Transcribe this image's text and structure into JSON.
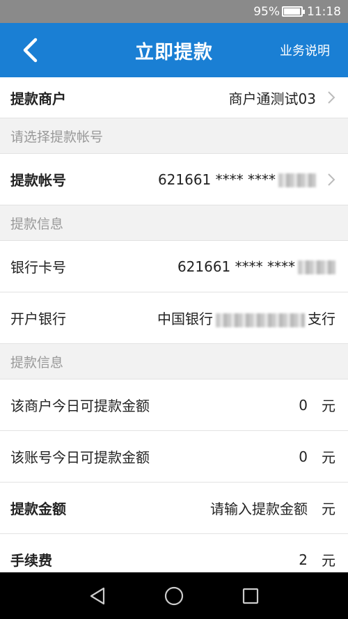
{
  "status_bar": {
    "battery": "95%",
    "time": "11:18"
  },
  "nav": {
    "title": "立即提款",
    "help": "业务说明"
  },
  "merchant": {
    "label": "提款商户",
    "value": "商户通测试03"
  },
  "section_account": "请选择提款帐号",
  "account": {
    "label": "提款帐号",
    "value": "621661 **** ****"
  },
  "section_info_1": "提款信息",
  "card": {
    "label": "银行卡号",
    "value": "621661 **** ****"
  },
  "bank": {
    "label": "开户银行",
    "prefix": "中国银行",
    "suffix": "支行"
  },
  "section_info_2": "提款信息",
  "merchant_limit": {
    "label": "该商户今日可提款金额",
    "amount": "0",
    "unit": "元"
  },
  "account_limit": {
    "label": "该账号今日可提款金额",
    "amount": "0",
    "unit": "元"
  },
  "withdraw_amount": {
    "label": "提款金额",
    "placeholder": "请输入提款金额",
    "unit": "元"
  },
  "fee": {
    "label": "手续费",
    "amount": "2",
    "unit": "元"
  },
  "colors": {
    "primary": "#1a7fd4",
    "amount": "#e0241f",
    "status_bar": "#8a8a8a"
  },
  "icons": {
    "back": "chevron-left-icon",
    "row_arrow": "chevron-right-icon",
    "nav_back": "triangle-back-icon",
    "nav_home": "circle-home-icon",
    "nav_recent": "square-recent-icon"
  }
}
